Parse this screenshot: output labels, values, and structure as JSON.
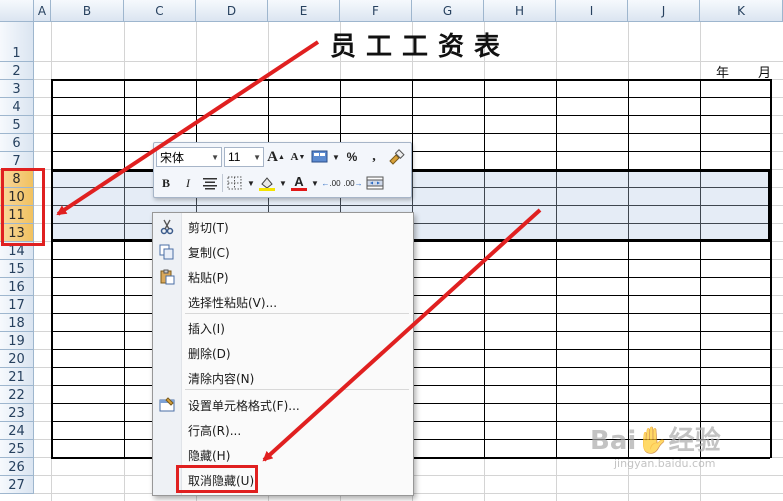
{
  "columns": [
    "A",
    "B",
    "C",
    "D",
    "E",
    "F",
    "G",
    "H",
    "I",
    "J",
    "K"
  ],
  "rows": [
    {
      "label": "1",
      "selected": false
    },
    {
      "label": "2",
      "selected": false
    },
    {
      "label": "3",
      "selected": false
    },
    {
      "label": "4",
      "selected": false
    },
    {
      "label": "5",
      "selected": false
    },
    {
      "label": "6",
      "selected": false
    },
    {
      "label": "7",
      "selected": false
    },
    {
      "label": "8",
      "selected": true
    },
    {
      "label": "10",
      "selected": true
    },
    {
      "label": "11",
      "selected": true
    },
    {
      "label": "13",
      "selected": true
    },
    {
      "label": "14",
      "selected": false
    },
    {
      "label": "15",
      "selected": false
    },
    {
      "label": "16",
      "selected": false
    },
    {
      "label": "17",
      "selected": false
    },
    {
      "label": "18",
      "selected": false
    },
    {
      "label": "19",
      "selected": false
    },
    {
      "label": "20",
      "selected": false
    },
    {
      "label": "21",
      "selected": false
    },
    {
      "label": "22",
      "selected": false
    },
    {
      "label": "23",
      "selected": false
    },
    {
      "label": "24",
      "selected": false
    },
    {
      "label": "25",
      "selected": false
    },
    {
      "label": "26",
      "selected": false
    },
    {
      "label": "27",
      "selected": false
    }
  ],
  "sheet": {
    "title": "员工工资表",
    "year_label": "年",
    "month_label": "月"
  },
  "mini_toolbar": {
    "font_name": "宋体",
    "font_size": "11",
    "grow_font": "A",
    "shrink_font": "A",
    "percent": "%",
    "comma": ",",
    "bold": "B",
    "italic": "I",
    "font_color_letter": "A",
    "inc_decimal": ".00",
    "dec_decimal": ".00"
  },
  "context_menu": {
    "items": [
      {
        "label": "剪切(T)",
        "icon": "scissors-icon"
      },
      {
        "label": "复制(C)",
        "icon": "copy-icon"
      },
      {
        "label": "粘贴(P)",
        "icon": "paste-icon"
      },
      {
        "label": "选择性粘贴(V)...",
        "icon": ""
      },
      {
        "label": "插入(I)",
        "icon": ""
      },
      {
        "label": "删除(D)",
        "icon": ""
      },
      {
        "label": "清除内容(N)",
        "icon": ""
      },
      {
        "label": "设置单元格格式(F)...",
        "icon": "format-cells-icon"
      },
      {
        "label": "行高(R)...",
        "icon": ""
      },
      {
        "label": "隐藏(H)",
        "icon": ""
      },
      {
        "label": "取消隐藏(U)",
        "icon": "",
        "highlighted_box": true
      }
    ]
  },
  "watermark": {
    "brand": "Bai",
    "brand2": "经验",
    "url": "jingyan.baidu.com"
  },
  "colors": {
    "annotation_red": "#e02020",
    "header_blue": "#dbe5f1",
    "selected_row_header": "#f1c15f"
  }
}
